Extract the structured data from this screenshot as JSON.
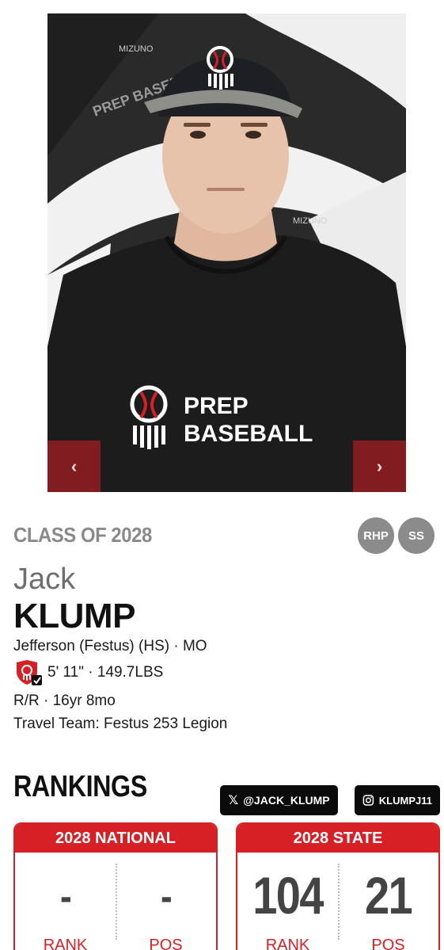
{
  "photo": {
    "shirt_logo_line1": "PREP",
    "shirt_logo_line2": "BASEBALL",
    "backdrop_brand": "PREP BASEBALL",
    "backdrop_sponsor": "MIZUNO"
  },
  "carousel": {
    "prev_icon": "chevron-left-icon",
    "next_icon": "chevron-right-icon"
  },
  "player": {
    "class_label": "CLASS OF 2028",
    "positions": [
      "RHP",
      "SS"
    ],
    "first_name": "Jack",
    "last_name": "KLUMP",
    "school_line": "Jefferson (Festus) (HS) · MO",
    "size_line": "5' 11\" · 149.7LBS",
    "bats_line": "R/R · 16yr 8mo",
    "travel_line": "Travel Team: Festus 253 Legion"
  },
  "rankings": {
    "title": "RANKINGS",
    "social_x": "@JACK_KLUMP",
    "social_ig": "KLUMPJ11",
    "national": {
      "header": "2028 NATIONAL",
      "rank": "-",
      "pos": "-",
      "rank_label": "RANK",
      "pos_label": "POS"
    },
    "state": {
      "header": "2028 STATE",
      "rank": "104",
      "pos": "21",
      "rank_label": "RANK",
      "pos_label": "POS"
    }
  },
  "colors": {
    "accent": "#d71f26",
    "badge": "#8b8b8b",
    "muted": "#8a8a8a"
  }
}
